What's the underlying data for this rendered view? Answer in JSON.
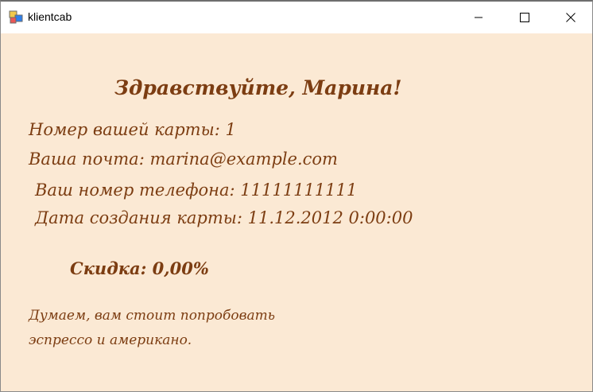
{
  "window": {
    "title": "klientcab"
  },
  "client": {
    "greeting": "Здравствуйте, Марина!",
    "card_number": "Номер вашей карты: 1",
    "email": "Ваша почта: marina@example.com",
    "phone": "Ваш номер телефона: 11111111111",
    "created": "Дата создания карты: 11.12.2012 0:00:00",
    "discount": "Скидка: 0,00%",
    "advice_line1": "Думаем, вам стоит попробовать",
    "advice_line2": "эспрессо и американо."
  },
  "colors": {
    "background": "#fbe9d4",
    "text": "#7c3d12"
  },
  "icons": {
    "app": "app-icon",
    "minimize": "minimize-icon",
    "maximize": "maximize-icon",
    "close": "close-icon"
  }
}
